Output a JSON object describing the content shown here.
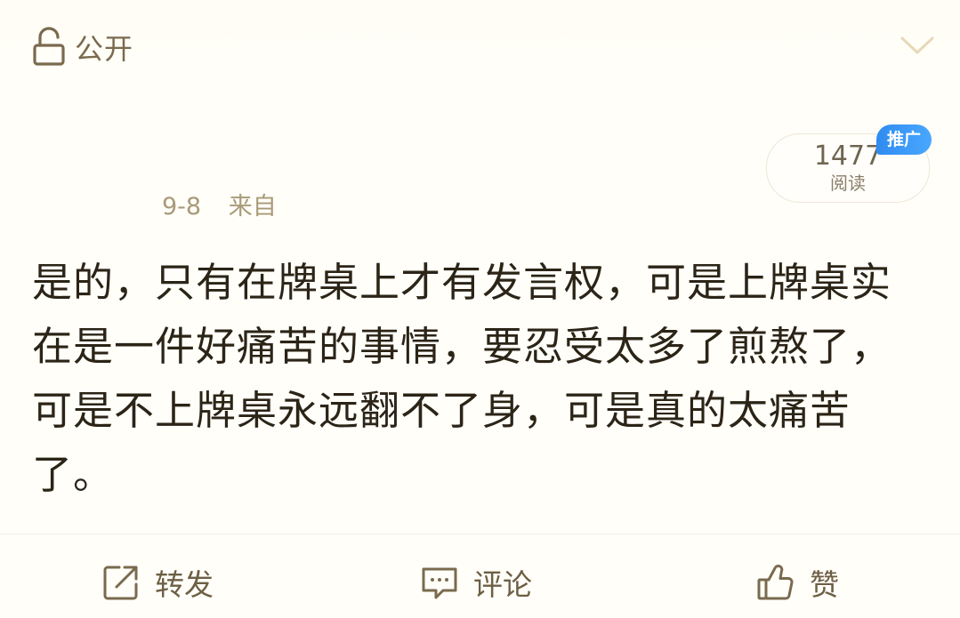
{
  "header": {
    "visibility_label": "公开",
    "visibility_icon": "lock-icon",
    "expand_icon": "chevron-down-icon"
  },
  "post_meta": {
    "date": "9-8",
    "source": "来自"
  },
  "reads": {
    "count": "1477",
    "unit": "阅读",
    "promo_label": "推广"
  },
  "post": {
    "text": "是的，只有在牌桌上才有发言权，可是上牌桌实在是一件好痛苦的事情，要忍受太多了煎熬了，可是不上牌桌永远翻不了身，可是真的太痛苦了。"
  },
  "actions": {
    "forward_label": "转发",
    "comment_label": "评论",
    "like_label": "赞"
  },
  "colors": {
    "accent": "#2f8cf0",
    "icon": "#7a6a4e",
    "background": "#fffef9"
  }
}
